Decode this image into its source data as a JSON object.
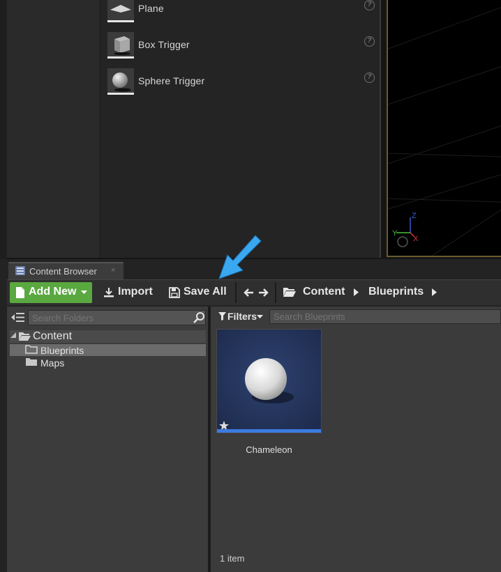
{
  "place_items": [
    {
      "label": "Plane",
      "icon": "plane-thumbnail-icon"
    },
    {
      "label": "Box Trigger",
      "icon": "box-trigger-thumbnail-icon"
    },
    {
      "label": "Sphere Trigger",
      "icon": "sphere-trigger-thumbnail-icon"
    }
  ],
  "viewport": {
    "axis_z": "Z",
    "axis_y": "Y",
    "axis_x": "X"
  },
  "content_browser": {
    "tab_label": "Content Browser",
    "tab_close": "×",
    "toolbar": {
      "add_new": "Add New",
      "import": "Import",
      "save_all": "Save All"
    },
    "breadcrumb": [
      "Content",
      "Blueprints"
    ],
    "search_folders_placeholder": "Search Folders",
    "filters_label": "Filters",
    "search_assets_placeholder": "Search Blueprints",
    "tree": {
      "root": "Content",
      "children": [
        "Blueprints",
        "Maps"
      ],
      "selected": "Blueprints"
    },
    "asset": {
      "name": "Chameleon"
    },
    "item_count": "1 item"
  },
  "colors": {
    "add_new_green": "#5aa840",
    "asset_bar_blue": "#3b7be0",
    "annotation_arrow": "#3aa8f0"
  }
}
